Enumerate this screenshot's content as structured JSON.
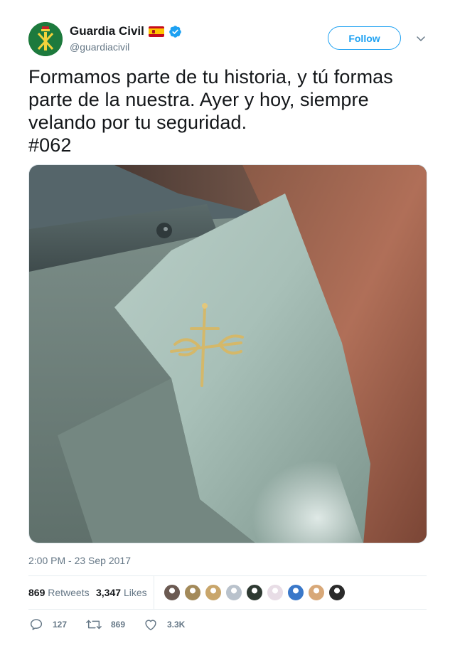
{
  "user": {
    "display_name": "Guardia Civil",
    "handle": "@guardiacivil",
    "verified": true,
    "avatar_color": "#1d7a3d",
    "avatar_emblem_color": "#f3d23b"
  },
  "follow_button": {
    "label": "Follow",
    "color": "#1da1f2"
  },
  "tweet": {
    "lines": [
      "Formamos parte de tu historia, y tú formas",
      "parte de la nuestra. Ayer y hoy, siempre",
      "velando por tu seguridad."
    ],
    "hashtag": "#062"
  },
  "timestamp": "2:00 PM - 23 Sep 2017",
  "stats": {
    "retweets_count": "869",
    "retweets_label": "Retweets",
    "likes_count": "3,347",
    "likes_label": "Likes"
  },
  "likers": [
    {
      "color": "#6b5a52"
    },
    {
      "color": "#a38a5a"
    },
    {
      "color": "#c9a66b"
    },
    {
      "color": "#b9c2cc"
    },
    {
      "color": "#2e3a32"
    },
    {
      "color": "#e8dde6"
    },
    {
      "color": "#3a78c9"
    },
    {
      "color": "#d8a878"
    },
    {
      "color": "#2a2a2a"
    }
  ],
  "actions": {
    "reply_count": "127",
    "retweet_count": "869",
    "like_count": "3.3K"
  },
  "icons": {
    "verified": "verified-badge-icon",
    "flag": "spain-flag-icon",
    "chevron": "chevron-down-icon",
    "reply": "reply-icon",
    "retweet": "retweet-icon",
    "like": "heart-icon"
  }
}
